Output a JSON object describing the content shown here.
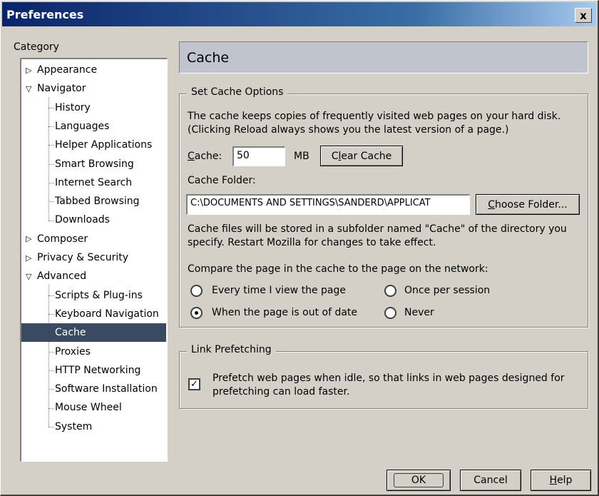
{
  "window": {
    "title": "Preferences",
    "close_glyph": "x"
  },
  "sidebar": {
    "label": "Category",
    "items": [
      {
        "label": "Appearance",
        "type": "collapsed"
      },
      {
        "label": "Navigator",
        "type": "expanded"
      },
      {
        "label": "History",
        "type": "child"
      },
      {
        "label": "Languages",
        "type": "child"
      },
      {
        "label": "Helper Applications",
        "type": "child"
      },
      {
        "label": "Smart Browsing",
        "type": "child"
      },
      {
        "label": "Internet Search",
        "type": "child"
      },
      {
        "label": "Tabbed Browsing",
        "type": "child"
      },
      {
        "label": "Downloads",
        "type": "child"
      },
      {
        "label": "Composer",
        "type": "collapsed"
      },
      {
        "label": "Privacy & Security",
        "type": "collapsed"
      },
      {
        "label": "Advanced",
        "type": "expanded"
      },
      {
        "label": "Scripts & Plug-ins",
        "type": "child"
      },
      {
        "label": "Keyboard Navigation",
        "type": "child"
      },
      {
        "label": "Cache",
        "type": "child",
        "selected": true
      },
      {
        "label": "Proxies",
        "type": "child"
      },
      {
        "label": "HTTP Networking",
        "type": "child"
      },
      {
        "label": "Software Installation",
        "type": "child"
      },
      {
        "label": "Mouse Wheel",
        "type": "child"
      },
      {
        "label": "System",
        "type": "child"
      }
    ],
    "selected_color": "#3a4a61"
  },
  "panel": {
    "title": "Cache",
    "cache_options": {
      "legend": "Set Cache Options",
      "description_line1": "The cache keeps copies of frequently visited web pages on your hard disk.",
      "description_line2": "(Clicking Reload always shows you the latest version of a page.)",
      "cache_label_accel": "C",
      "cache_label_rest": "ache:",
      "cache_value": "50",
      "cache_unit": "MB",
      "clear_cache_accel": "l",
      "clear_cache_pre": "C",
      "clear_cache_post": "ear Cache",
      "folder_label": "Cache Folder:",
      "folder_value": "C:\\DOCUMENTS AND SETTINGS\\SANDERD\\APPLICAT",
      "choose_folder_pre": "",
      "choose_folder_accel": "C",
      "choose_folder_post": "hoose Folder...",
      "note_line1": "Cache files will be stored in a subfolder named \"Cache\" of the directory you",
      "note_line2": "specify. Restart Mozilla for changes to take effect.",
      "compare_label": "Compare the page in the cache to the page on the network:",
      "radios": {
        "every_time": "Every time I view the page",
        "once_per_session": "Once per session",
        "out_of_date": "When the page is out of date",
        "never": "Never"
      },
      "selected_radio": "out_of_date"
    },
    "link_prefetching": {
      "legend": "Link Prefetching",
      "checkbox_line1": "Prefetch web pages when idle, so that links in web pages designed for",
      "checkbox_line2": "prefetching can load faster.",
      "checked": true,
      "check_glyph": "✓"
    }
  },
  "footer": {
    "ok": "OK",
    "cancel": "Cancel",
    "help_accel": "H",
    "help_rest": "elp"
  }
}
